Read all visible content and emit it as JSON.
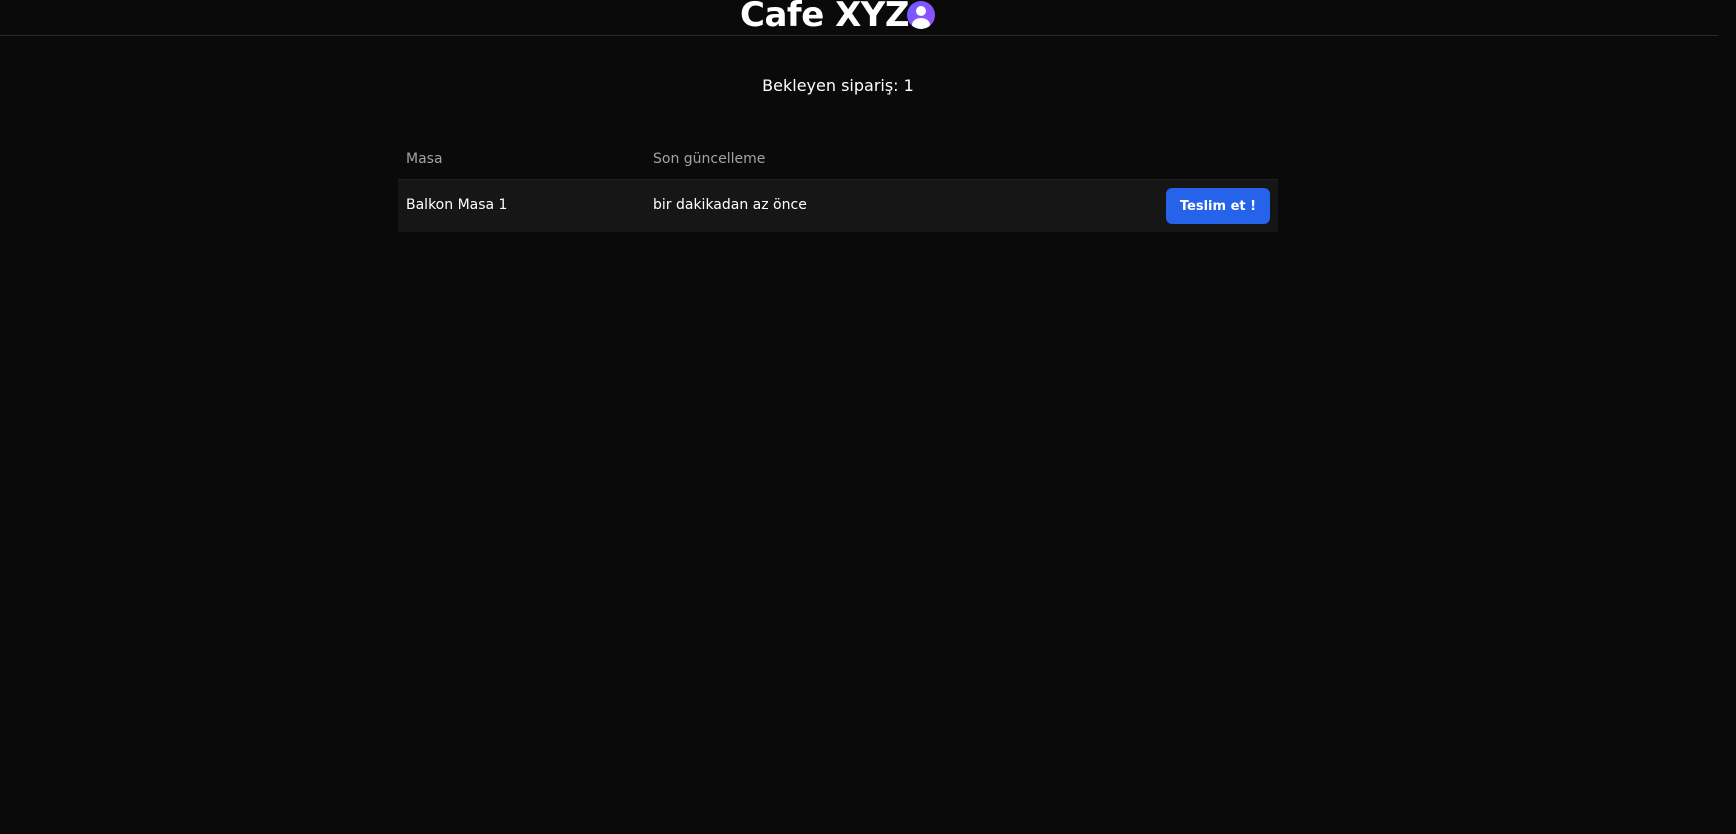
{
  "header": {
    "brand_title": "Cafe XYZ",
    "avatar_icon": "user-avatar-icon"
  },
  "summary": {
    "pending_orders_text": "Bekleyen sipariş: 1"
  },
  "orders_table": {
    "columns": [
      "Masa",
      "Son güncelleme"
    ],
    "rows": [
      {
        "table_name": "Balkon Masa 1",
        "last_update": "bir dakikadan az önce",
        "action_label": "Teslim et !"
      }
    ]
  },
  "colors": {
    "background": "#0a0a0a",
    "row_background": "#161616",
    "accent": "#2563eb",
    "avatar_gradient_start": "#6d5bff",
    "avatar_gradient_end": "#9b4dff"
  }
}
